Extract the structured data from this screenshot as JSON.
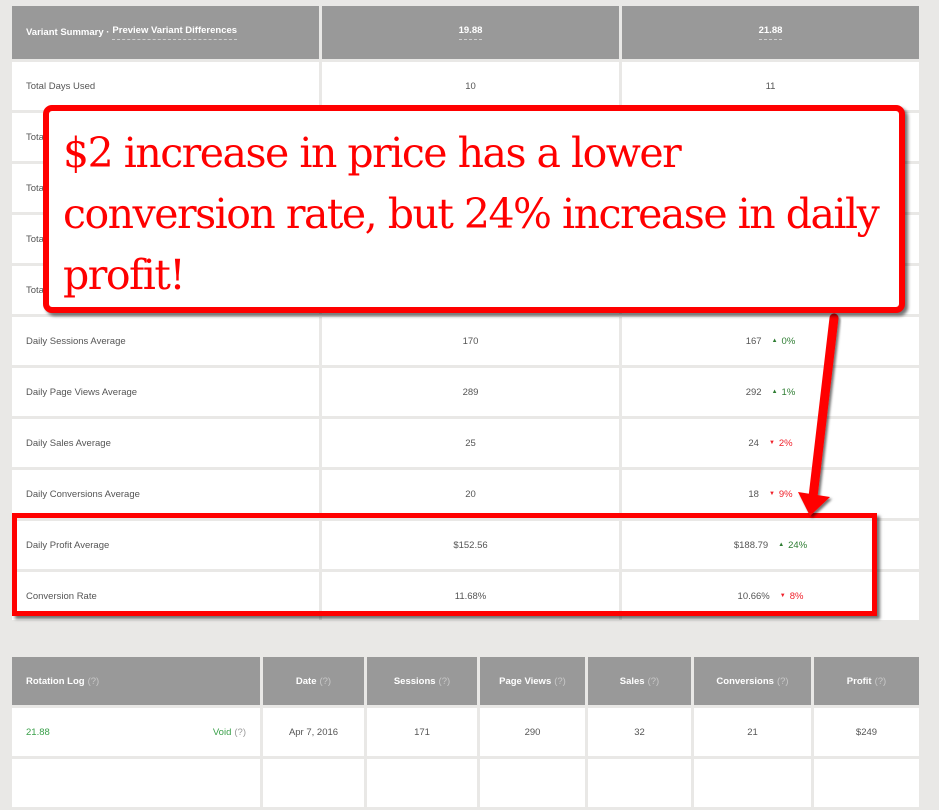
{
  "summary": {
    "header": {
      "title_prefix": "Variant Summary · ",
      "title_link": "Preview Variant Differences",
      "variant_a": "19.88",
      "variant_b": "21.88"
    },
    "rows": [
      {
        "label": "Total Days Used",
        "a": "10",
        "b": "11",
        "delta": "",
        "dir": ""
      },
      {
        "label": "Total",
        "a": "",
        "b": "",
        "delta": "",
        "dir": ""
      },
      {
        "label": "Total",
        "a": "",
        "b": "",
        "delta": "",
        "dir": ""
      },
      {
        "label": "Total",
        "a": "",
        "b": "",
        "delta": "",
        "dir": ""
      },
      {
        "label": "Total",
        "a": "",
        "b": "",
        "delta": "",
        "dir": ""
      },
      {
        "label": "Daily Sessions Average",
        "a": "170",
        "b": "167",
        "delta": "0%",
        "dir": "up"
      },
      {
        "label": "Daily Page Views Average",
        "a": "289",
        "b": "292",
        "delta": "1%",
        "dir": "up"
      },
      {
        "label": "Daily Sales Average",
        "a": "25",
        "b": "24",
        "delta": "2%",
        "dir": "down"
      },
      {
        "label": "Daily Conversions Average",
        "a": "20",
        "b": "18",
        "delta": "9%",
        "dir": "down"
      },
      {
        "label": "Daily Profit Average",
        "a": "$152.56",
        "b": "$188.79",
        "delta": "24%",
        "dir": "up"
      },
      {
        "label": "Conversion Rate",
        "a": "11.68%",
        "b": "10.66%",
        "delta": "8%",
        "dir": "down"
      }
    ]
  },
  "rotation": {
    "headers": [
      "Rotation Log",
      "Date",
      "Sessions",
      "Page Views",
      "Sales",
      "Conversions",
      "Profit"
    ],
    "help_label": "(?)",
    "rows": [
      {
        "variant": "21.88",
        "status": "Void",
        "date": "Apr 7, 2016",
        "sessions": "171",
        "page_views": "290",
        "sales": "32",
        "conversions": "21",
        "profit": "$249"
      }
    ]
  },
  "annotation": {
    "text": "$2 increase in price has a lower conversion rate, but 24% increase in daily profit!",
    "color": "#ff0000"
  },
  "colors": {
    "header_bg": "#999999",
    "up": "#2e7d32",
    "down": "#f0202a",
    "link_green": "#3aa04a"
  }
}
